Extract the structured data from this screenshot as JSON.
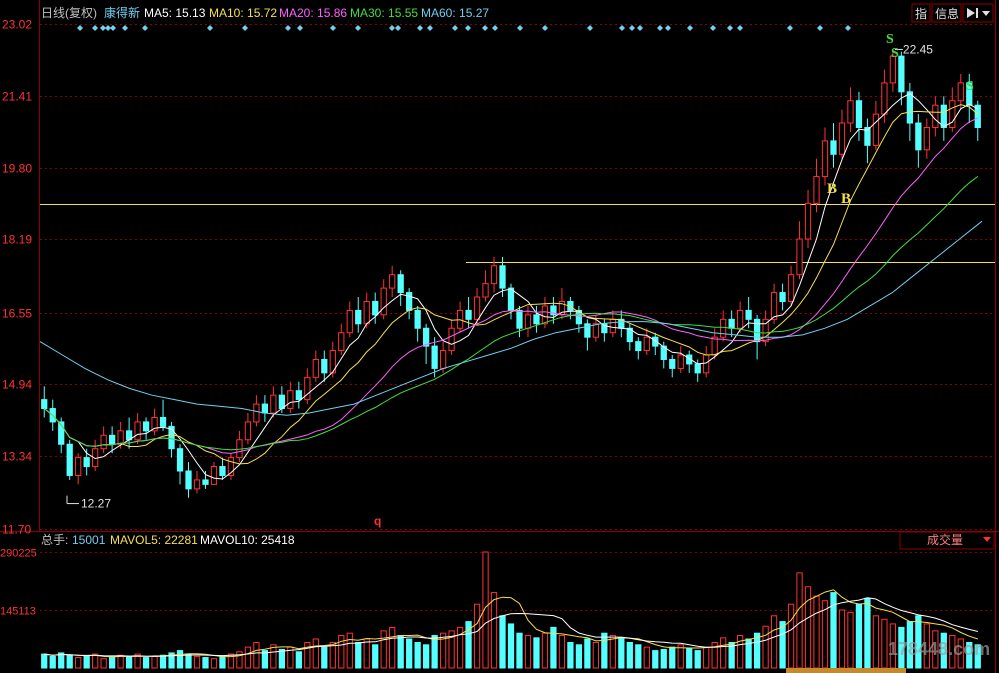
{
  "header": {
    "period": "日线(复权)",
    "stock_name": "康得新",
    "ma": [
      {
        "label": "MA5: 15.13",
        "color": "#ffffff"
      },
      {
        "label": "MA10: 15.72",
        "color": "#f5e04c"
      },
      {
        "label": "MA20: 15.86",
        "color": "#ff60ff"
      },
      {
        "label": "MA30: 15.55",
        "color": "#3fe03f"
      },
      {
        "label": "MA60: 15.27",
        "color": "#6fd0f0"
      }
    ],
    "buttons": [
      {
        "label": "指",
        "icon": ""
      },
      {
        "label": "信息",
        "icon": ""
      },
      {
        "label": "",
        "icon": "next-arrow-icon"
      }
    ]
  },
  "price_axis": {
    "ticks": [
      "23.02",
      "21.41",
      "19.80",
      "18.19",
      "16.55",
      "14.94",
      "13.34",
      "11.70"
    ],
    "values": [
      23.02,
      21.41,
      19.8,
      18.19,
      16.55,
      14.94,
      13.34,
      11.7
    ],
    "min": 11.7,
    "max": 23.02
  },
  "annotations": {
    "high": "22.45",
    "low": "12.27",
    "buy_marks": [
      "B",
      "B"
    ],
    "sell_marks": [
      "S",
      "S",
      "S"
    ],
    "bottom_mark": "q"
  },
  "volume_header": {
    "total_label": "总手:",
    "total_value": "15001",
    "mavol5": "MAVOL5: 22281",
    "mavol10": "MAVOL10: 25418",
    "selector": "成交量"
  },
  "volume_axis": {
    "ticks": [
      "290225",
      "145113"
    ],
    "values": [
      290225,
      145113
    ]
  },
  "watermark": "178448.com",
  "colors": {
    "up": "#ff3232",
    "down": "#54ffff",
    "grid": "#8b0000",
    "axis_text": "#ff3232",
    "hline": "#f5e04c"
  },
  "chart_data": {
    "type": "candlestick",
    "title": "",
    "xlabel": "",
    "ylabel": "",
    "ylim": [
      11.7,
      23.02
    ],
    "series": [
      {
        "name": "MA5",
        "value": 15.13
      },
      {
        "name": "MA10",
        "value": 15.72
      },
      {
        "name": "MA20",
        "value": 15.86
      },
      {
        "name": "MA30",
        "value": 15.55
      },
      {
        "name": "MA60",
        "value": 15.27
      }
    ],
    "ma60_curve": [
      15.9,
      15.6,
      15.3,
      15.05,
      14.85,
      14.7,
      14.6,
      14.5,
      14.45,
      14.4,
      14.3,
      14.25,
      14.3,
      14.4,
      14.5,
      14.7,
      14.9,
      15.1,
      15.3,
      15.45,
      15.6,
      15.75,
      15.95,
      16.1,
      16.2,
      16.3,
      16.35,
      16.35,
      16.3,
      16.2,
      16.1,
      16.05,
      16.0,
      16.0,
      16.05,
      16.2,
      16.4,
      16.7,
      17.0,
      17.4,
      17.8,
      18.2,
      18.6
    ],
    "candles": [
      [
        14.6,
        14.4,
        14.9,
        14.2
      ],
      [
        14.4,
        14.1,
        14.6,
        13.9
      ],
      [
        14.1,
        13.6,
        14.2,
        13.4
      ],
      [
        13.6,
        12.9,
        13.7,
        12.8
      ],
      [
        12.9,
        13.3,
        13.4,
        12.7
      ],
      [
        13.3,
        13.1,
        13.5,
        12.9
      ],
      [
        13.1,
        13.5,
        13.7,
        13.0
      ],
      [
        13.5,
        13.8,
        14.0,
        13.4
      ],
      [
        13.8,
        13.6,
        14.0,
        13.4
      ],
      [
        13.6,
        13.9,
        14.1,
        13.5
      ],
      [
        13.9,
        13.7,
        14.2,
        13.5
      ],
      [
        13.7,
        14.1,
        14.3,
        13.6
      ],
      [
        14.1,
        13.9,
        14.2,
        13.7
      ],
      [
        13.9,
        14.2,
        14.4,
        13.8
      ],
      [
        14.2,
        14.0,
        14.6,
        13.9
      ],
      [
        14.0,
        13.5,
        14.1,
        13.3
      ],
      [
        13.5,
        13.0,
        13.6,
        12.7
      ],
      [
        13.0,
        12.6,
        13.2,
        12.4
      ],
      [
        12.6,
        12.8,
        13.0,
        12.5
      ],
      [
        12.8,
        12.7,
        13.0,
        12.6
      ],
      [
        12.7,
        13.1,
        13.2,
        12.7
      ],
      [
        13.1,
        12.9,
        13.3,
        12.8
      ],
      [
        12.9,
        13.3,
        13.4,
        12.8
      ],
      [
        13.3,
        13.7,
        13.9,
        13.2
      ],
      [
        13.7,
        14.1,
        14.3,
        13.6
      ],
      [
        14.1,
        14.5,
        14.7,
        14.0
      ],
      [
        14.5,
        14.3,
        14.7,
        14.1
      ],
      [
        14.3,
        14.7,
        14.9,
        14.2
      ],
      [
        14.7,
        14.4,
        14.9,
        14.3
      ],
      [
        14.4,
        14.8,
        15.0,
        14.3
      ],
      [
        14.8,
        14.6,
        15.0,
        14.4
      ],
      [
        14.6,
        15.1,
        15.3,
        14.5
      ],
      [
        15.1,
        15.5,
        15.7,
        15.0
      ],
      [
        15.5,
        15.2,
        15.7,
        15.0
      ],
      [
        15.2,
        15.7,
        15.9,
        15.1
      ],
      [
        15.7,
        16.1,
        16.3,
        15.6
      ],
      [
        16.1,
        16.6,
        16.8,
        16.0
      ],
      [
        16.6,
        16.3,
        16.9,
        16.1
      ],
      [
        16.3,
        16.8,
        17.0,
        16.2
      ],
      [
        16.8,
        16.5,
        17.0,
        16.3
      ],
      [
        16.5,
        17.1,
        17.3,
        16.4
      ],
      [
        17.1,
        17.4,
        17.6,
        16.9
      ],
      [
        17.4,
        17.0,
        17.5,
        16.7
      ],
      [
        17.0,
        16.6,
        17.1,
        16.4
      ],
      [
        16.6,
        16.2,
        16.7,
        15.9
      ],
      [
        16.2,
        15.8,
        16.3,
        15.4
      ],
      [
        15.8,
        15.3,
        16.0,
        15.1
      ],
      [
        15.3,
        15.7,
        15.9,
        15.2
      ],
      [
        15.7,
        16.2,
        16.4,
        15.6
      ],
      [
        16.2,
        16.6,
        16.8,
        16.1
      ],
      [
        16.6,
        16.4,
        16.9,
        16.2
      ],
      [
        16.4,
        16.9,
        17.1,
        16.3
      ],
      [
        16.9,
        17.2,
        17.5,
        16.8
      ],
      [
        17.2,
        17.6,
        17.8,
        17.0
      ],
      [
        17.6,
        17.1,
        17.8,
        16.9
      ],
      [
        17.1,
        16.6,
        17.2,
        16.4
      ],
      [
        16.6,
        16.2,
        16.7,
        16.0
      ],
      [
        16.2,
        16.5,
        16.7,
        16.0
      ],
      [
        16.5,
        16.3,
        16.7,
        16.1
      ],
      [
        16.3,
        16.7,
        16.9,
        16.2
      ],
      [
        16.7,
        16.5,
        16.9,
        16.3
      ],
      [
        16.5,
        16.8,
        17.1,
        16.4
      ],
      [
        16.8,
        16.6,
        16.9,
        16.4
      ],
      [
        16.6,
        16.3,
        16.7,
        16.1
      ],
      [
        16.3,
        16.0,
        16.4,
        15.7
      ],
      [
        16.0,
        16.3,
        16.5,
        15.9
      ],
      [
        16.3,
        16.1,
        16.4,
        15.9
      ],
      [
        16.1,
        16.4,
        16.6,
        16.0
      ],
      [
        16.4,
        16.2,
        16.6,
        16.0
      ],
      [
        16.2,
        15.9,
        16.3,
        15.7
      ],
      [
        15.9,
        15.7,
        16.0,
        15.5
      ],
      [
        15.7,
        16.0,
        16.2,
        15.6
      ],
      [
        16.0,
        15.8,
        16.1,
        15.6
      ],
      [
        15.8,
        15.5,
        15.9,
        15.3
      ],
      [
        15.5,
        15.3,
        15.6,
        15.1
      ],
      [
        15.3,
        15.6,
        15.8,
        15.2
      ],
      [
        15.6,
        15.4,
        15.7,
        15.2
      ],
      [
        15.4,
        15.2,
        15.5,
        15.0
      ],
      [
        15.2,
        15.6,
        15.8,
        15.1
      ],
      [
        15.6,
        16.0,
        16.2,
        15.5
      ],
      [
        16.0,
        16.4,
        16.6,
        15.9
      ],
      [
        16.4,
        16.2,
        16.6,
        16.0
      ],
      [
        16.2,
        16.6,
        16.8,
        16.1
      ],
      [
        16.6,
        16.4,
        16.9,
        16.2
      ],
      [
        16.4,
        15.9,
        16.5,
        15.5
      ],
      [
        15.9,
        16.4,
        16.6,
        15.8
      ],
      [
        16.4,
        17.0,
        17.2,
        16.3
      ],
      [
        17.0,
        16.8,
        17.2,
        16.6
      ],
      [
        16.8,
        17.4,
        17.6,
        16.7
      ],
      [
        17.4,
        18.2,
        18.6,
        17.3
      ],
      [
        18.2,
        19.0,
        19.3,
        18.0
      ],
      [
        19.0,
        19.6,
        20.0,
        18.8
      ],
      [
        19.6,
        20.4,
        20.7,
        19.4
      ],
      [
        20.4,
        20.1,
        20.8,
        19.8
      ],
      [
        20.1,
        20.8,
        21.1,
        20.0
      ],
      [
        20.8,
        21.3,
        21.6,
        20.6
      ],
      [
        21.3,
        20.7,
        21.5,
        20.4
      ],
      [
        20.7,
        20.3,
        20.9,
        19.9
      ],
      [
        20.3,
        21.0,
        21.3,
        20.2
      ],
      [
        21.0,
        21.7,
        22.0,
        20.8
      ],
      [
        21.7,
        22.3,
        22.45,
        21.5
      ],
      [
        22.3,
        21.5,
        22.4,
        21.2
      ],
      [
        21.5,
        20.8,
        21.7,
        20.4
      ],
      [
        20.8,
        20.2,
        21.0,
        19.8
      ],
      [
        20.2,
        20.7,
        20.9,
        20.0
      ],
      [
        20.7,
        21.2,
        21.4,
        20.5
      ],
      [
        21.2,
        20.7,
        21.4,
        20.4
      ],
      [
        20.7,
        21.3,
        21.6,
        20.6
      ],
      [
        21.3,
        21.7,
        21.9,
        21.1
      ],
      [
        21.7,
        21.2,
        21.9,
        20.8
      ],
      [
        21.2,
        20.7,
        21.3,
        20.4
      ]
    ],
    "volume_candles_fraction": [
      0.12,
      0.1,
      0.13,
      0.11,
      0.09,
      0.1,
      0.12,
      0.08,
      0.09,
      0.11,
      0.1,
      0.12,
      0.09,
      0.1,
      0.11,
      0.13,
      0.15,
      0.12,
      0.1,
      0.09,
      0.08,
      0.1,
      0.12,
      0.14,
      0.18,
      0.22,
      0.15,
      0.2,
      0.16,
      0.18,
      0.14,
      0.22,
      0.25,
      0.18,
      0.22,
      0.28,
      0.3,
      0.22,
      0.25,
      0.2,
      0.32,
      0.35,
      0.28,
      0.25,
      0.22,
      0.2,
      0.28,
      0.3,
      0.32,
      0.35,
      0.4,
      0.55,
      1.0,
      0.65,
      0.45,
      0.38,
      0.3,
      0.28,
      0.26,
      0.3,
      0.35,
      0.28,
      0.22,
      0.2,
      0.25,
      0.22,
      0.3,
      0.28,
      0.26,
      0.22,
      0.2,
      0.18,
      0.15,
      0.16,
      0.18,
      0.2,
      0.17,
      0.15,
      0.18,
      0.22,
      0.26,
      0.22,
      0.28,
      0.25,
      0.3,
      0.36,
      0.45,
      0.4,
      0.55,
      0.82,
      0.7,
      0.62,
      0.58,
      0.65,
      0.5,
      0.48,
      0.55,
      0.6,
      0.45,
      0.42,
      0.38,
      0.35,
      0.4,
      0.45,
      0.38,
      0.32,
      0.3,
      0.28,
      0.25,
      0.22,
      0.2
    ]
  }
}
